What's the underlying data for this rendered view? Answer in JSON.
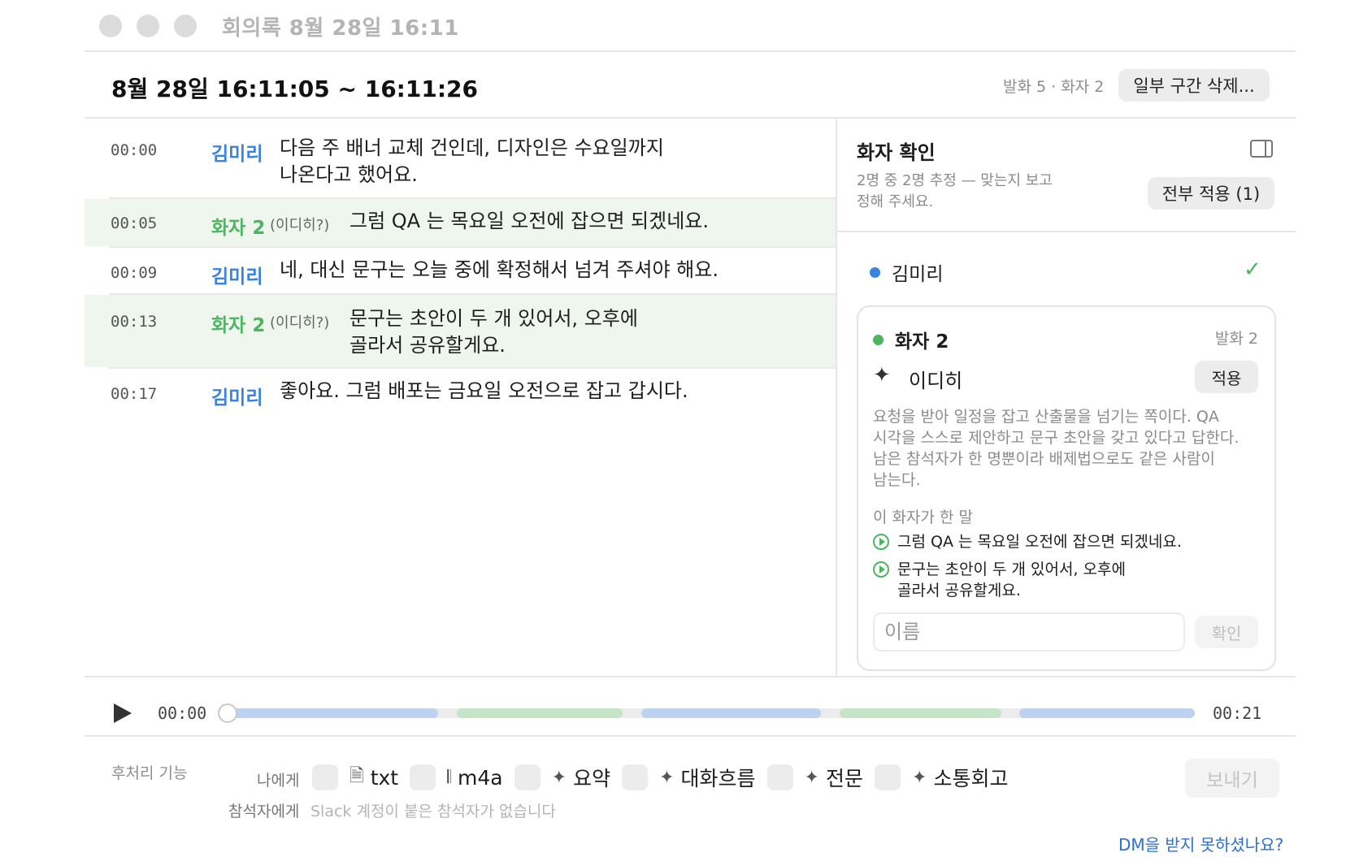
{
  "window": {
    "title": "회의록 8월 28일 16:11"
  },
  "header": {
    "range": "8월 28일 16:11:05 ~ 16:11:26",
    "counts": "발화 5 · 화자 2",
    "delete_label": "일부 구간 삭제..."
  },
  "transcript": [
    {
      "time": "00:00",
      "speaker": "김미리",
      "speaker_color": "#3a82e0",
      "guess": "",
      "text": "다음 주 배너 교체 건인데, 디자인은 수요일까지\n나온다고 했어요.",
      "highlighted": false
    },
    {
      "time": "00:05",
      "speaker": "화자 2",
      "speaker_color": "#4cb561",
      "guess": "(이디히?)",
      "text": "그럼 QA 는 목요일 오전에 잡으면 되겠네요.",
      "highlighted": true
    },
    {
      "time": "00:09",
      "speaker": "김미리",
      "speaker_color": "#3a82e0",
      "guess": "",
      "text": "네, 대신 문구는 오늘 중에 확정해서 넘겨 주셔야 해요.",
      "highlighted": false
    },
    {
      "time": "00:13",
      "speaker": "화자 2",
      "speaker_color": "#4cb561",
      "guess": "(이디히?)",
      "text": "문구는 초안이 두 개 있어서, 오후에\n골라서 공유할게요.",
      "highlighted": true
    },
    {
      "time": "00:17",
      "speaker": "김미리",
      "speaker_color": "#3a82e0",
      "guess": "",
      "text": "좋아요. 그럼 배포는 금요일 오전으로 잡고 갑시다.",
      "highlighted": false
    }
  ],
  "side_panel": {
    "title": "화자 확인",
    "subtitle": "2명 중 2명 추정 — 맞는지 보고\n정해 주세요.",
    "apply_all_label": "전부 적용 (1)",
    "panel_icon": "sidebar-toggle-icon",
    "confirmed_speaker": {
      "name": "김미리",
      "color": "#3a82e0",
      "check": "✓"
    },
    "card": {
      "speaker": "화자 2",
      "color": "#4cb561",
      "utterance_count": "발화 2",
      "suggestion": "이디히",
      "suggestion_icon": "sparkle-icon",
      "apply_label": "적용",
      "reason": "요청을 받아 일정을 잡고 산출물을 넘기는 쪽이다. QA\n시각을 스스로 제안하고 문구 초안을 갖고 있다고 답한다.\n남은 참석자가 한 명뿐이라 배제법으로도 같은 사람이\n남는다.",
      "said_label": "이 화자가 한 말",
      "said": [
        "그럼 QA 는 목요일 오전에 잡으면 되겠네요.",
        "문구는 초안이 두 개 있어서, 오후에\n골라서 공유할게요."
      ],
      "name_placeholder": "이름",
      "confirm_label": "확인"
    }
  },
  "player": {
    "current_time": "00:00",
    "end_time": "00:21",
    "progress": 0,
    "segments": [
      {
        "start": 0,
        "end": 4.6,
        "color": "blue"
      },
      {
        "start": 5,
        "end": 8.6,
        "color": "green"
      },
      {
        "start": 9,
        "end": 12.9,
        "color": "blue"
      },
      {
        "start": 13.3,
        "end": 16.8,
        "color": "green"
      },
      {
        "start": 17.2,
        "end": 21,
        "color": "blue"
      }
    ],
    "duration_seconds": 21
  },
  "footer": {
    "post_label": "후처리 기능",
    "to_me_label": "나에게",
    "to_attendees_label": "참석자에게",
    "attendees_note": "Slack 계정이 붙은 참석자가 없습니다",
    "options": [
      {
        "label": "txt",
        "icon": "document-icon",
        "glyph": "🗎"
      },
      {
        "label": "m4a",
        "icon": "waveform-icon",
        "glyph": "𝄃"
      },
      {
        "label": "요약",
        "icon": "sparkle-icon",
        "glyph": "✦"
      },
      {
        "label": "대화흐름",
        "icon": "sparkle-icon",
        "glyph": "✦"
      },
      {
        "label": "전문",
        "icon": "sparkle-icon",
        "glyph": "✦"
      },
      {
        "label": "소통회고",
        "icon": "sparkle-icon",
        "glyph": "✦"
      }
    ],
    "send_label": "보내기",
    "dm_link": "DM을 받지 못하셨나요?"
  }
}
